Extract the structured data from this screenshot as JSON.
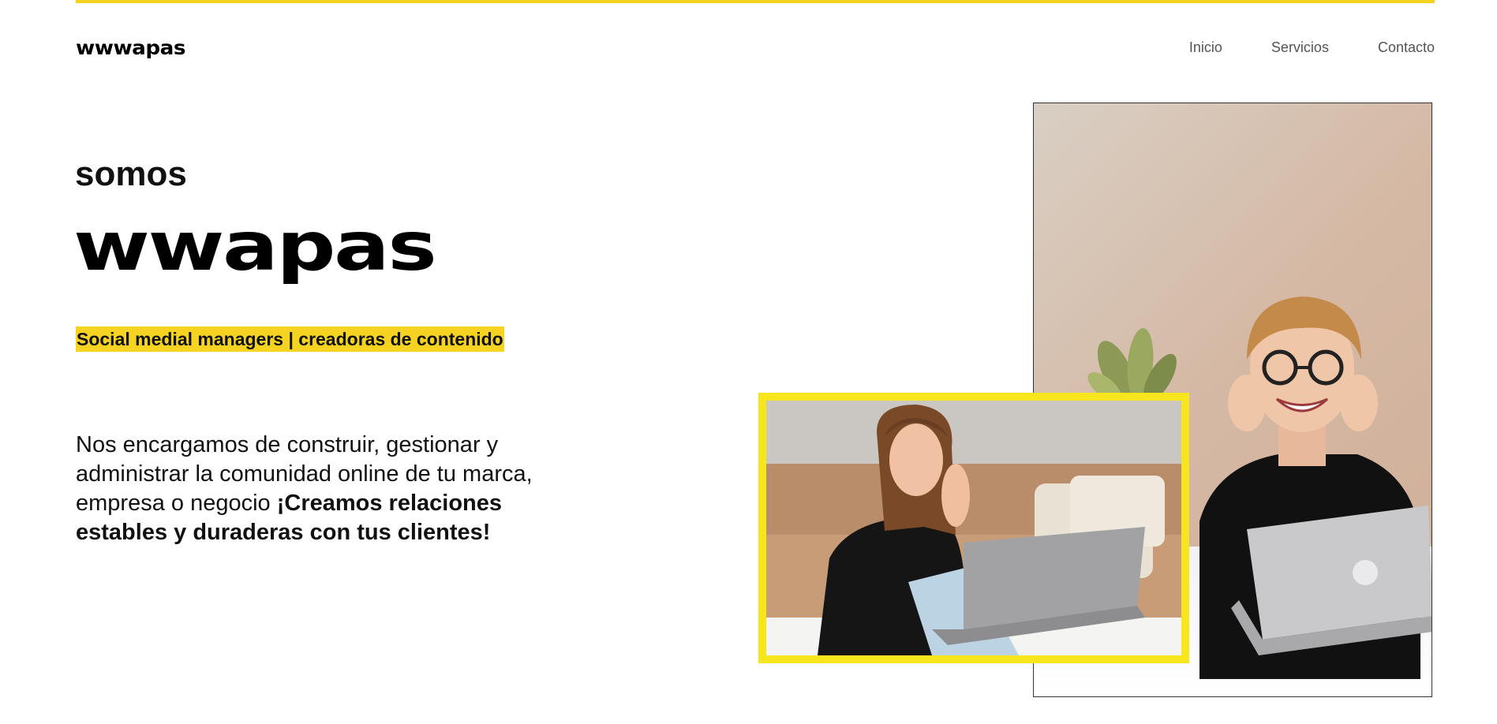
{
  "header": {
    "logo": "wwwapas",
    "nav": [
      "Inicio",
      "Servicios",
      "Contacto"
    ]
  },
  "hero": {
    "eyebrow": "somos",
    "brand": "wwapas",
    "tagline": "Social medial managers | creadoras de contenido",
    "description_plain": "Nos encargamos de construir, gestionar y administrar la comunidad online de tu marca, empresa o negocio ",
    "description_bold": "¡Creamos relaciones estables y duraderas con tus clientes!"
  },
  "colors": {
    "accent": "#f5d320",
    "frame": "#f7e51e",
    "text": "#111111",
    "nav_text": "#555555"
  },
  "images": {
    "large_photo": "woman-smiling-with-laptop-photo",
    "small_photo": "woman-on-floor-with-laptop-photo"
  }
}
